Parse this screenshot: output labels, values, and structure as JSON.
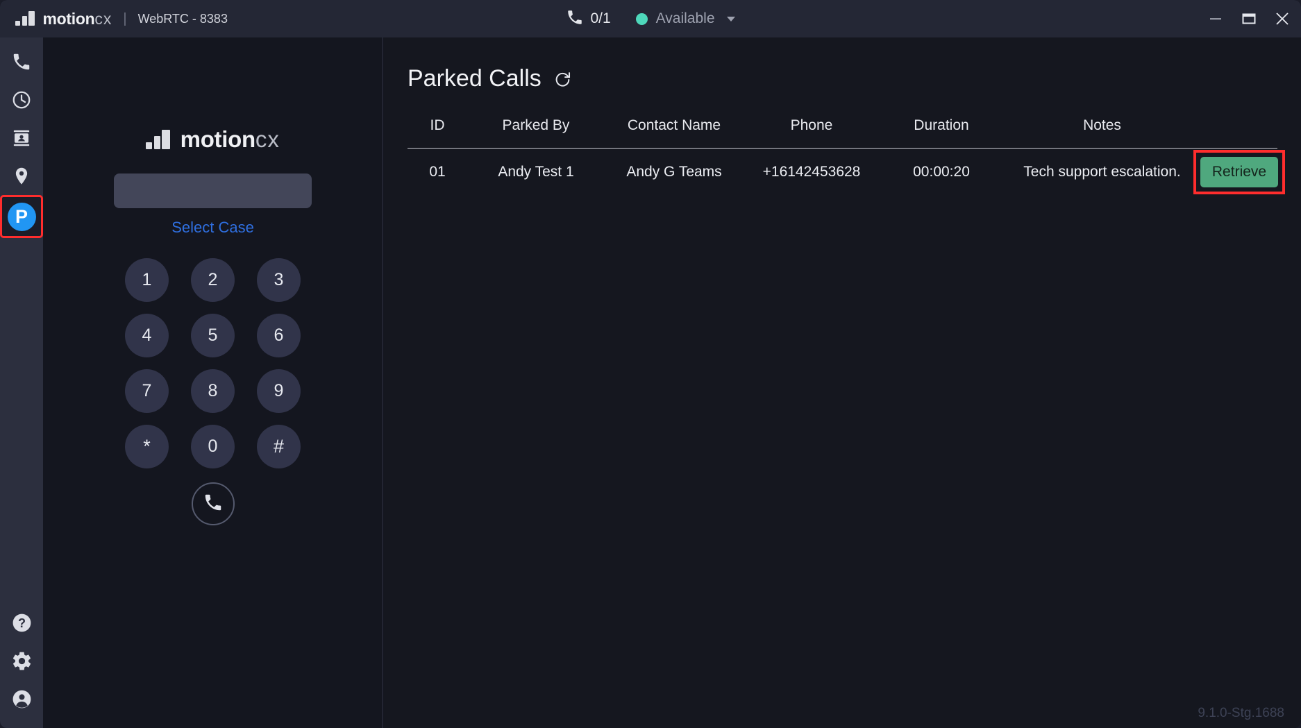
{
  "titlebar": {
    "brand_name": "motion",
    "brand_suffix": "cx",
    "separator": "|",
    "subtitle": "WebRTC - 8383",
    "call_count": "0/1",
    "call_icon": "phone-icon",
    "status_label": "Available",
    "status_color": "#4ed8bb",
    "window_controls": {
      "minimize": "minimize-icon",
      "maximize": "maximize-icon",
      "close": "close-icon"
    }
  },
  "rail": {
    "items": [
      {
        "name": "phone-icon",
        "label": "Dialer",
        "active": false
      },
      {
        "name": "history-clock-icon",
        "label": "History",
        "active": false
      },
      {
        "name": "contacts-icon",
        "label": "Contacts",
        "active": false
      },
      {
        "name": "location-pin-icon",
        "label": "Location",
        "active": false
      },
      {
        "name": "parked-calls-icon",
        "label": "P",
        "active": true
      }
    ],
    "bottom_items": [
      {
        "name": "help-icon",
        "label": "Help"
      },
      {
        "name": "settings-gear-icon",
        "label": "Settings"
      },
      {
        "name": "account-icon",
        "label": "Account"
      }
    ],
    "active_highlight_color": "#ff2d2d",
    "park_badge_color": "#2196f3"
  },
  "dialer": {
    "brand_name": "motion",
    "brand_suffix": "cx",
    "number_value": "",
    "number_placeholder": "",
    "select_case_label": "Select Case",
    "select_case_color": "#2f6fe0",
    "keys": [
      "1",
      "2",
      "3",
      "4",
      "5",
      "6",
      "7",
      "8",
      "9",
      "*",
      "0",
      "#"
    ],
    "call_button_icon": "phone-call-icon"
  },
  "main": {
    "page_title": "Parked Calls",
    "refresh_icon": "refresh-icon",
    "table": {
      "columns": [
        "ID",
        "Parked By",
        "Contact Name",
        "Phone",
        "Duration",
        "Notes",
        ""
      ],
      "rows": [
        {
          "id": "01",
          "parked_by": "Andy Test 1",
          "contact_name": "Andy G Teams",
          "phone": "+16142453628",
          "duration": "00:00:20",
          "notes": "Tech support escalation.",
          "action_label": "Retrieve",
          "action_color": "#4fa87e",
          "action_highlighted": true
        }
      ]
    },
    "version": "9.1.0-Stg.1688"
  }
}
